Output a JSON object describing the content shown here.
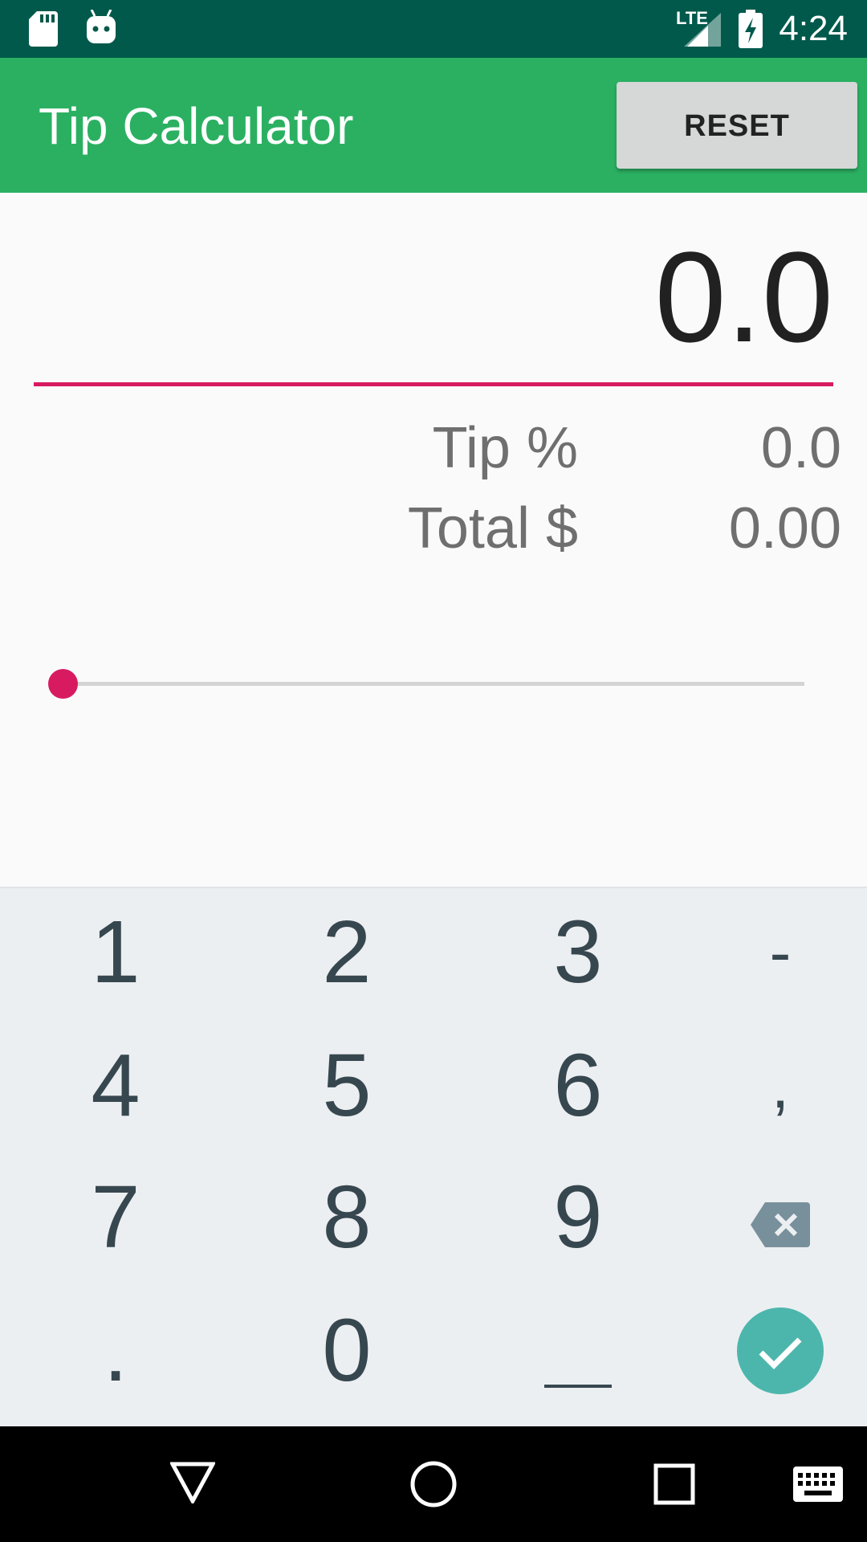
{
  "status_bar": {
    "time": "4:24",
    "network": "LTE",
    "icons": [
      "sd-card-icon",
      "android-icon",
      "signal-icon",
      "battery-charging-icon"
    ]
  },
  "app_bar": {
    "title": "Tip Calculator",
    "reset_label": "RESET"
  },
  "bill": {
    "value": "0.0"
  },
  "summary": {
    "tip_label": "Tip %",
    "tip_value": "0.0",
    "total_label": "Total $",
    "total_value": "0.00"
  },
  "slider": {
    "value_fraction": 0
  },
  "keyboard": {
    "rows": [
      [
        "1",
        "2",
        "3",
        "-"
      ],
      [
        "4",
        "5",
        "6",
        ","
      ],
      [
        "7",
        "8",
        "9",
        "backspace-icon"
      ],
      [
        ".",
        "0",
        "space",
        "done-check-icon"
      ]
    ]
  },
  "nav_bar": {
    "icons": [
      "back-icon",
      "home-icon",
      "recents-icon",
      "keyboard-icon"
    ]
  },
  "colors": {
    "status_bar": "#01594b",
    "app_bar": "#2bb062",
    "accent": "#d81b60",
    "keyboard_bg": "#eceff1",
    "key_text": "#37474f",
    "done_button": "#4db6ac"
  }
}
